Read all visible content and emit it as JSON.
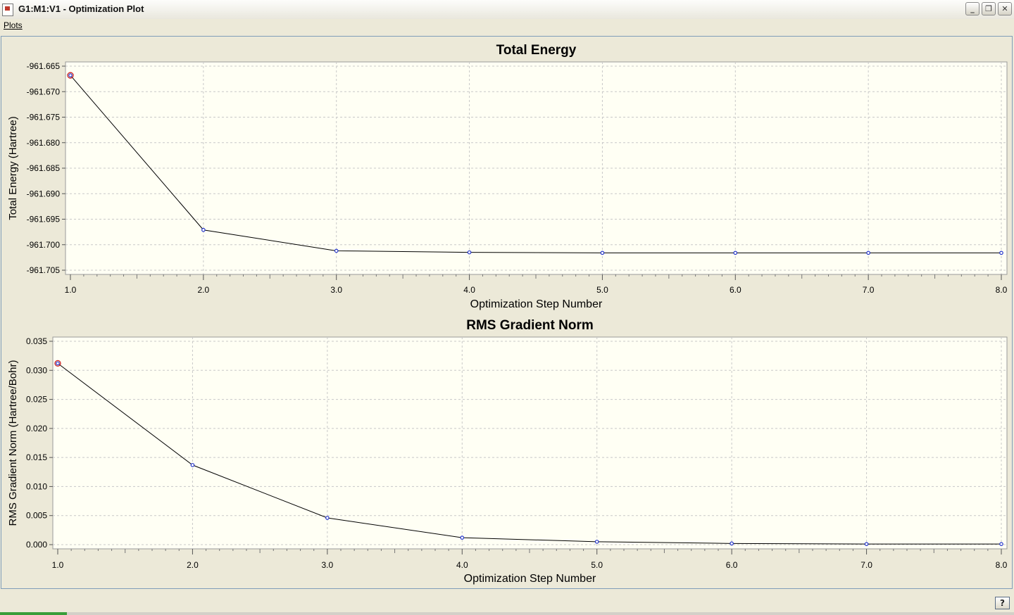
{
  "window": {
    "title": "G1:M1:V1 - Optimization Plot",
    "minimize_glyph": "_",
    "restore_glyph": "❐",
    "close_glyph": "✕"
  },
  "menu": {
    "items": [
      {
        "label": "Plots"
      }
    ]
  },
  "help_button": {
    "glyph": "?"
  },
  "colors": {
    "plot_bg": "#fffff4",
    "grid": "#c8c8c8",
    "line": "#000000",
    "marker": "#2233cc",
    "highlight": "#cc2222"
  },
  "chart_data": [
    {
      "type": "line",
      "title": "Total Energy",
      "xlabel": "Optimization Step Number",
      "ylabel": "Total Energy (Hartree)",
      "x": [
        1,
        2,
        3,
        4,
        5,
        6,
        7,
        8
      ],
      "series": [
        {
          "values": [
            -961.6668,
            -961.6971,
            -961.7012,
            -961.7015,
            -961.7016,
            -961.7016,
            -961.7016,
            -961.7016
          ]
        }
      ],
      "xlim": [
        1.0,
        8.0
      ],
      "ylim": [
        -961.705,
        -961.665
      ],
      "xticks": [
        "1.0",
        "2.0",
        "3.0",
        "4.0",
        "5.0",
        "6.0",
        "7.0",
        "8.0"
      ],
      "yticks": [
        "-961.665",
        "-961.670",
        "-961.675",
        "-961.680",
        "-961.685",
        "-961.690",
        "-961.695",
        "-961.700",
        "-961.705"
      ],
      "grid": true,
      "highlighted_point": 1
    },
    {
      "type": "line",
      "title": "RMS Gradient Norm",
      "xlabel": "Optimization Step Number",
      "ylabel": "RMS Gradient Norm (Hartree/Bohr)",
      "x": [
        1,
        2,
        3,
        4,
        5,
        6,
        7,
        8
      ],
      "series": [
        {
          "values": [
            0.0312,
            0.0137,
            0.0046,
            0.0012,
            0.0005,
            0.0002,
            0.0001,
            0.0001
          ]
        }
      ],
      "xlim": [
        1.0,
        8.0
      ],
      "ylim": [
        0.0,
        0.035
      ],
      "xticks": [
        "1.0",
        "2.0",
        "3.0",
        "4.0",
        "5.0",
        "6.0",
        "7.0",
        "8.0"
      ],
      "yticks": [
        "0.035",
        "0.030",
        "0.025",
        "0.020",
        "0.015",
        "0.010",
        "0.005",
        "0.000"
      ],
      "grid": true,
      "highlighted_point": 1
    }
  ]
}
